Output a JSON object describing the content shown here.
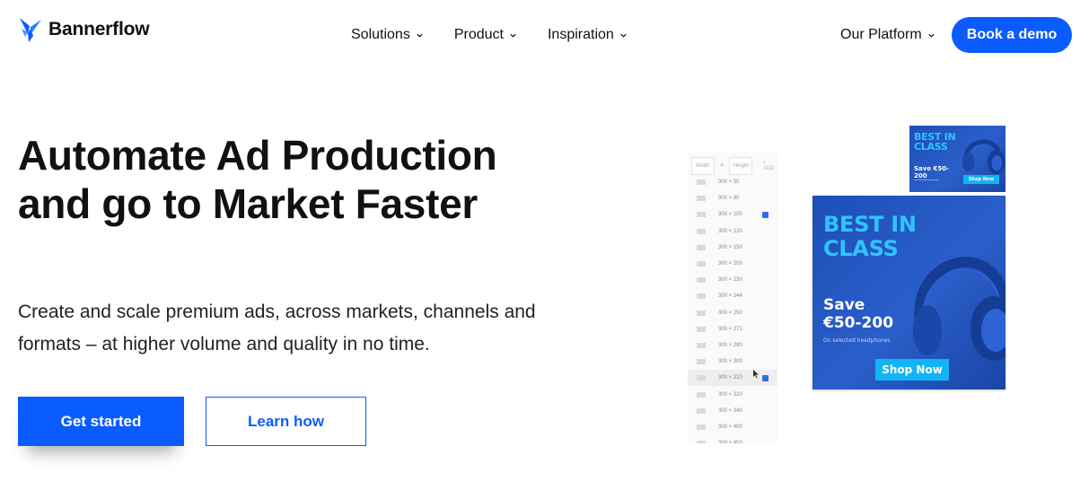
{
  "header": {
    "logo_text": "Bannerflow",
    "nav": [
      {
        "label": "Solutions"
      },
      {
        "label": "Product"
      },
      {
        "label": "Inspiration"
      }
    ],
    "platform_label": "Our Platform",
    "demo_label": "Book a demo"
  },
  "hero": {
    "title": "Automate Ad Production and go to Market Faster",
    "subtitle": "Create and scale premium ads, across markets, channels and formats – at higher volume and quality in no time.",
    "primary_cta": "Get started",
    "secondary_cta": "Learn how"
  },
  "illustration": {
    "size_panel": {
      "width_placeholder": "Width",
      "height_placeholder": "Height",
      "separator": "×",
      "add_label": "+ ADD",
      "sizes": [
        {
          "label": "300 × 50",
          "checked": false
        },
        {
          "label": "300 × 80",
          "checked": false
        },
        {
          "label": "300 × 100",
          "checked": true
        },
        {
          "label": "300 × 120",
          "checked": false
        },
        {
          "label": "300 × 150",
          "checked": false
        },
        {
          "label": "300 × 200",
          "checked": false
        },
        {
          "label": "300 × 230",
          "checked": false
        },
        {
          "label": "300 × 244",
          "checked": false
        },
        {
          "label": "300 × 250",
          "checked": false
        },
        {
          "label": "300 × 271",
          "checked": false
        },
        {
          "label": "300 × 280",
          "checked": false
        },
        {
          "label": "300 × 300",
          "checked": false
        },
        {
          "label": "300 × 310",
          "checked": true
        },
        {
          "label": "300 × 320",
          "checked": false
        },
        {
          "label": "300 × 340",
          "checked": false
        },
        {
          "label": "300 × 400",
          "checked": false
        },
        {
          "label": "300 × 450",
          "checked": false
        }
      ]
    },
    "ad_small": {
      "headline": "BEST IN CLASS",
      "save": "Save €50-200",
      "cta": "Shop Now"
    },
    "ad_large": {
      "headline": "BEST IN CLASS",
      "save": "Save €50-200",
      "note": "On selected headphones",
      "cta": "Shop Now"
    },
    "colors": {
      "brand_blue": "#0b5cff",
      "ad_bg": "#2455c2",
      "ad_headline": "#30c4ff",
      "ad_cta": "#13b4f7"
    }
  }
}
